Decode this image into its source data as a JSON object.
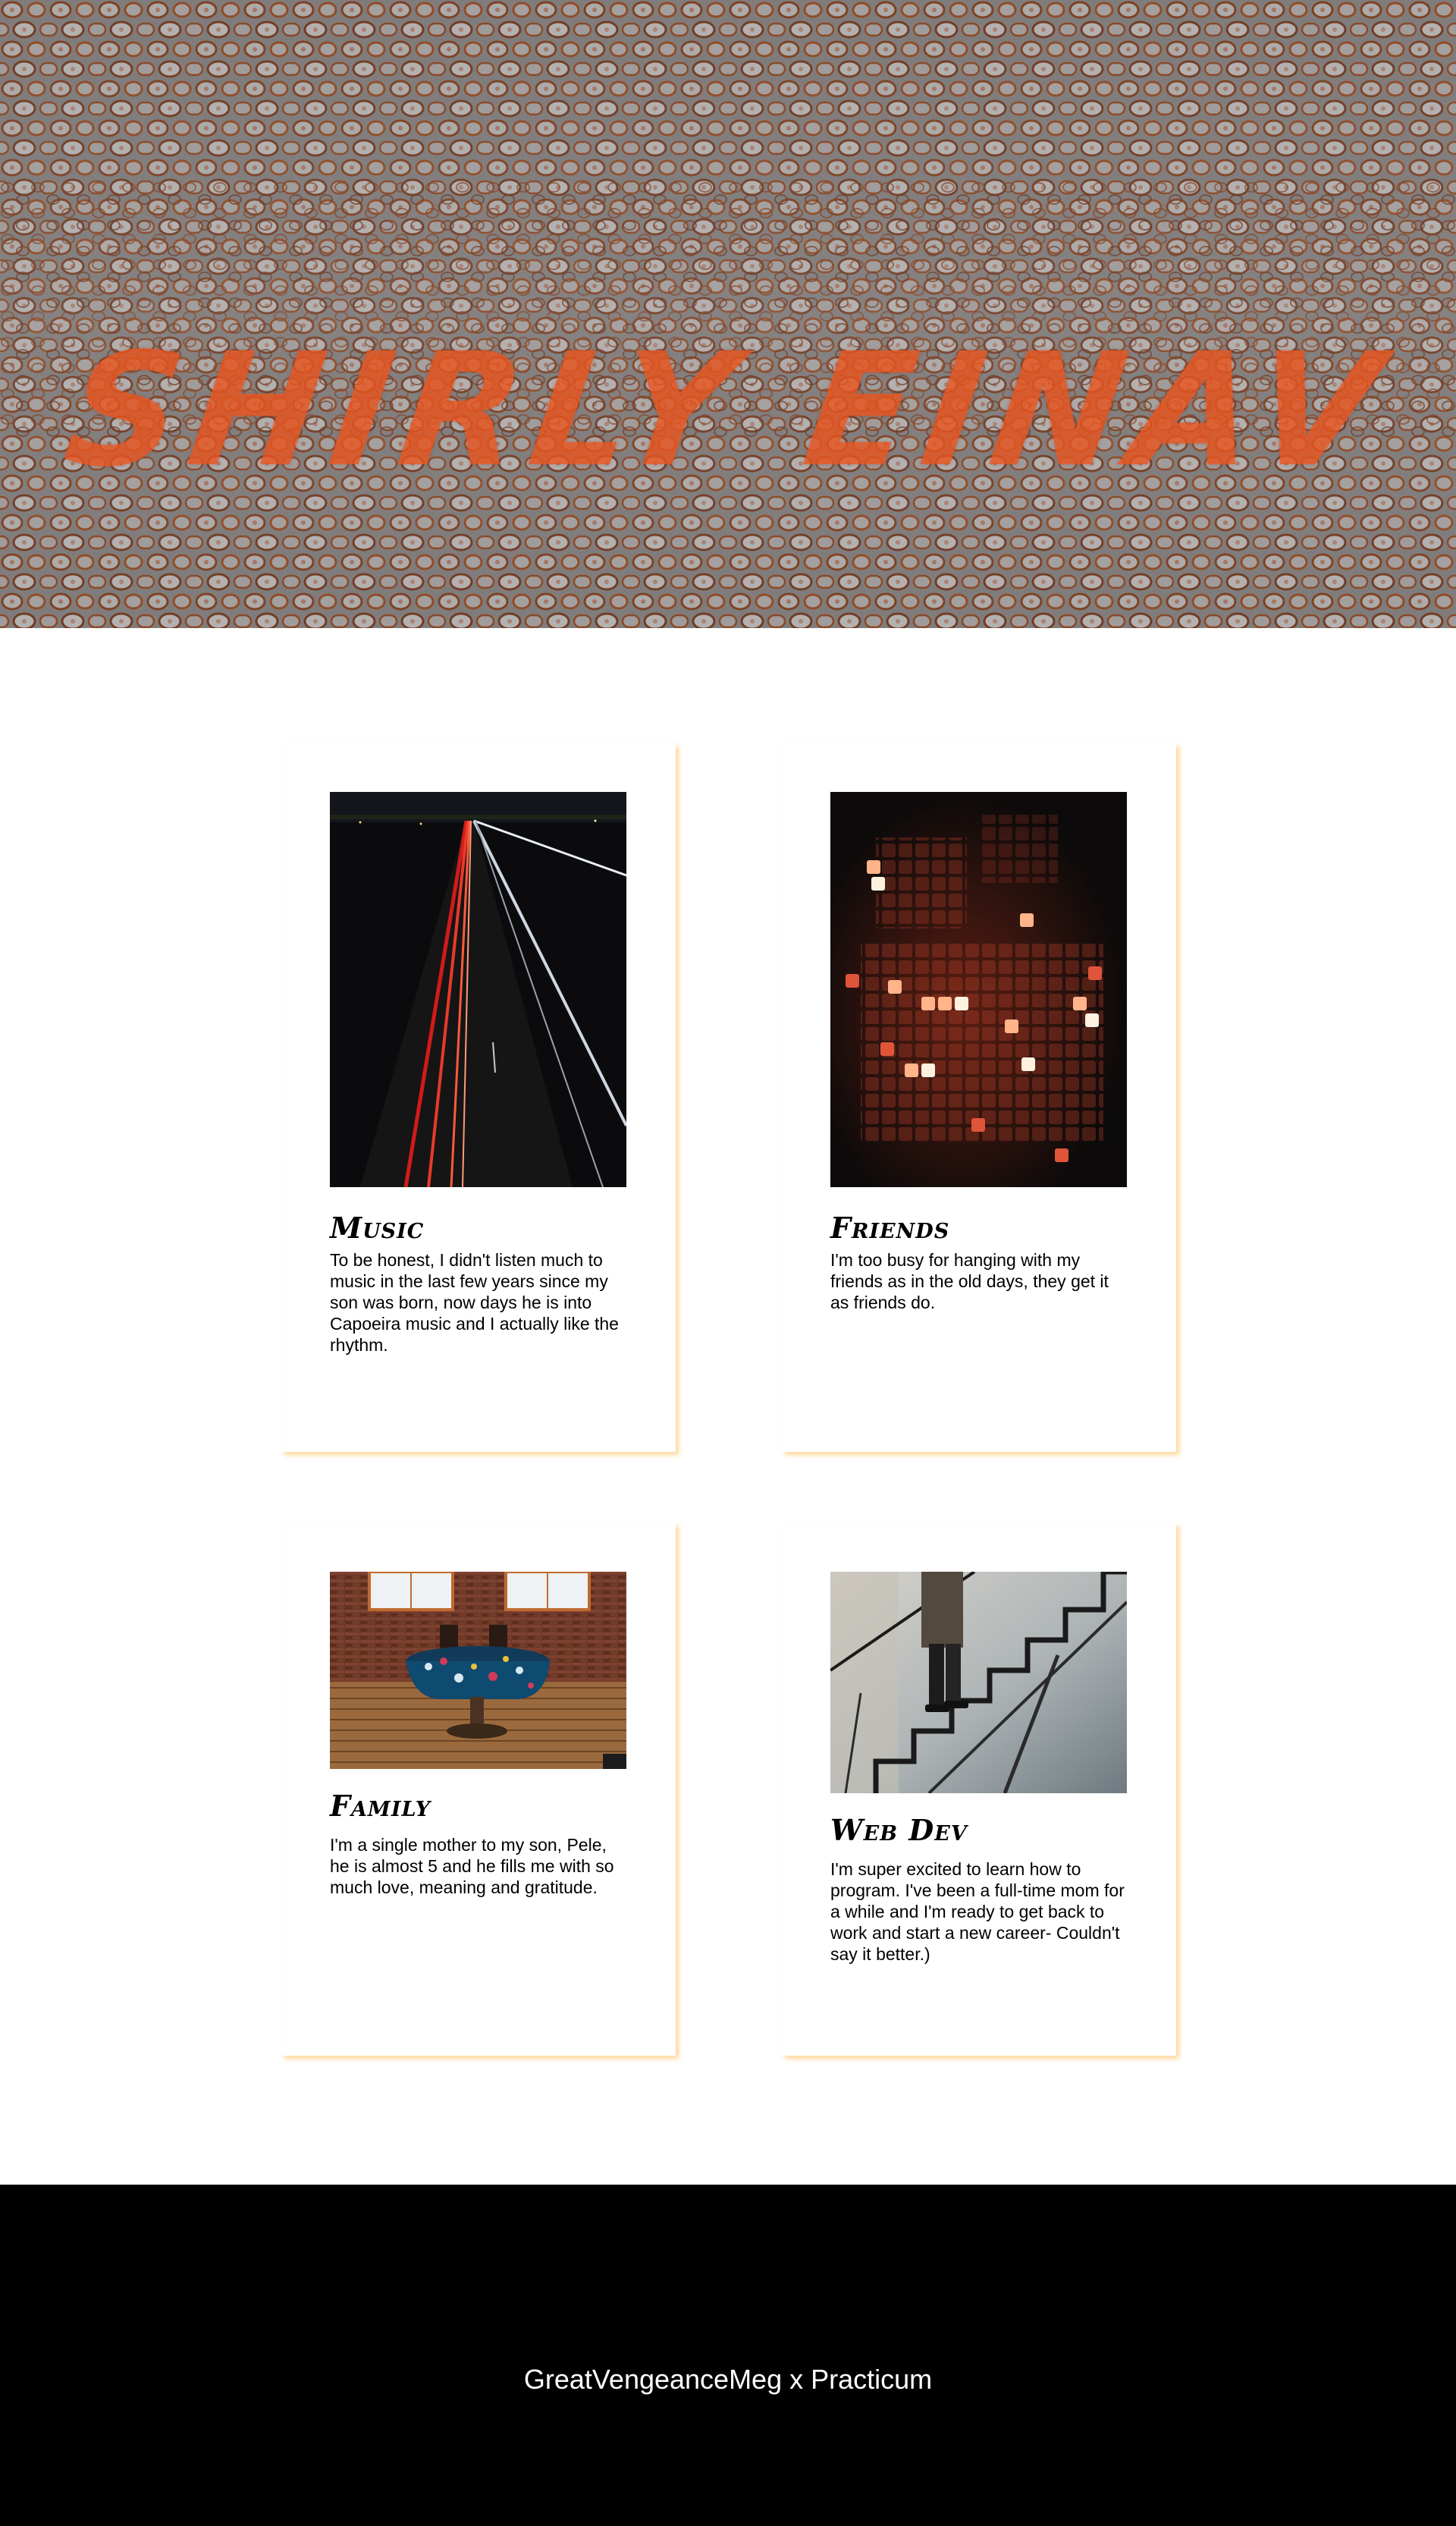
{
  "hero": {
    "title": "SHIRLY EINAV",
    "image": "abstract-fluid-cell-pattern"
  },
  "cards": [
    {
      "title": "Music",
      "text": "To be honest, I didn't listen much to music in the last few years since my son was born, now days he is into Capoeira music and I actually like the rhythm.",
      "image": "highway-light-trails-at-night"
    },
    {
      "title": "Friends",
      "text": "I'm too busy for hanging with my friends as in the old days, they get it as friends do.",
      "image": "bokeh-pixel-lights"
    },
    {
      "title": "Family",
      "text": "I'm a single mother to my son, Pele, he is almost 5 and he fills me with so much love, meaning and gratitude.",
      "image": "table-in-brick-room"
    },
    {
      "title": "Web Dev",
      "text": "I'm super excited to learn how to program. I've been a full-time mom for a while and I'm ready to get back to work and start a new career- Couldn't say it better.)",
      "image": "person-on-glass-staircase"
    }
  ],
  "footer": {
    "text": "GreatVengeanceMeg x Practicum"
  },
  "colors": {
    "hero_title": "#e8551f",
    "card_shadow": "#ffc878",
    "footer_bg": "#000000",
    "footer_text": "#ffffff"
  }
}
